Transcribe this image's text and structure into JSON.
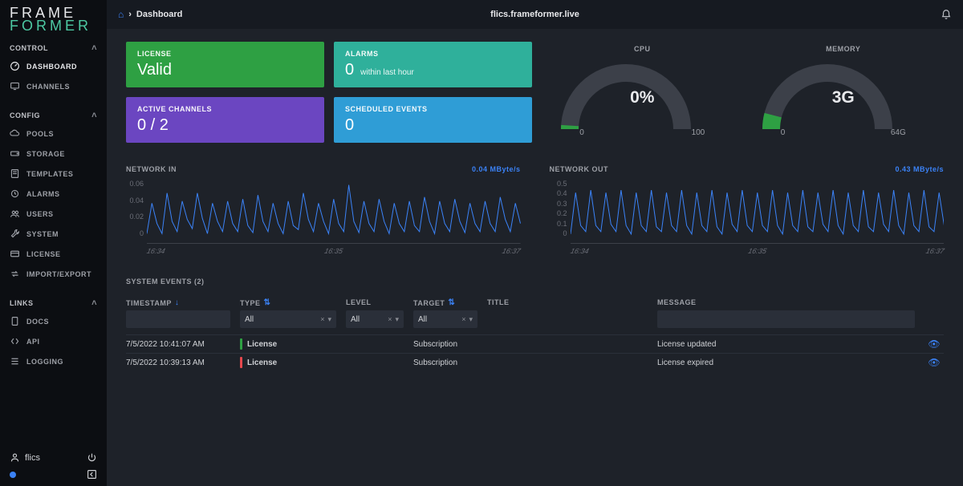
{
  "logo": {
    "line1": "FRAME",
    "line2": "FORMER"
  },
  "top": {
    "breadcrumb_page": "Dashboard",
    "host": "flics.frameformer.live"
  },
  "sidebar": {
    "sections": {
      "control_label": "CONTROL",
      "config_label": "CONFIG",
      "links_label": "LINKS"
    },
    "control": [
      {
        "label": "DASHBOARD",
        "icon": "gauge-icon",
        "active": true
      },
      {
        "label": "CHANNELS",
        "icon": "monitor-icon",
        "active": false
      }
    ],
    "config": [
      {
        "label": "POOLS",
        "icon": "cloud-icon"
      },
      {
        "label": "STORAGE",
        "icon": "drive-icon"
      },
      {
        "label": "TEMPLATES",
        "icon": "template-icon"
      },
      {
        "label": "ALARMS",
        "icon": "clock-icon"
      },
      {
        "label": "USERS",
        "icon": "users-icon"
      },
      {
        "label": "SYSTEM",
        "icon": "wrench-icon"
      },
      {
        "label": "LICENSE",
        "icon": "card-icon"
      },
      {
        "label": "IMPORT/EXPORT",
        "icon": "transfer-icon"
      }
    ],
    "links": [
      {
        "label": "DOCS",
        "icon": "doc-icon"
      },
      {
        "label": "API",
        "icon": "code-icon"
      },
      {
        "label": "LOGGING",
        "icon": "list-icon"
      }
    ],
    "user": "flics"
  },
  "cards": {
    "license_label": "LICENSE",
    "license_value": "Valid",
    "alarms_label": "ALARMS",
    "alarms_value": "0",
    "alarms_sub": "within last hour",
    "active_channels_label": "ACTIVE CHANNELS",
    "active_channels_value": "0 / 2",
    "scheduled_label": "SCHEDULED EVENTS",
    "scheduled_value": "0"
  },
  "gauges": {
    "cpu_label": "CPU",
    "cpu_value": "0%",
    "cpu_min": "0",
    "cpu_max": "100",
    "cpu_percent": 2,
    "memory_label": "MEMORY",
    "memory_value": "3G",
    "memory_min": "0",
    "memory_max": "64G",
    "memory_percent": 8
  },
  "chart_data": [
    {
      "type": "line",
      "title": "NETWORK IN",
      "rate_label": "0.04 MByte/s",
      "ylabel": "",
      "y_ticks": [
        "0.06",
        "0.04",
        "0.02",
        "0"
      ],
      "x_ticks": [
        "16:34",
        "16:35",
        "16:37"
      ],
      "ylim": [
        0,
        0.06
      ],
      "values": [
        0.01,
        0.04,
        0.02,
        0.01,
        0.05,
        0.022,
        0.012,
        0.042,
        0.024,
        0.015,
        0.05,
        0.025,
        0.01,
        0.04,
        0.022,
        0.012,
        0.042,
        0.02,
        0.012,
        0.044,
        0.018,
        0.011,
        0.048,
        0.022,
        0.012,
        0.04,
        0.02,
        0.01,
        0.042,
        0.018,
        0.014,
        0.05,
        0.024,
        0.012,
        0.04,
        0.022,
        0.01,
        0.044,
        0.02,
        0.012,
        0.058,
        0.022,
        0.011,
        0.042,
        0.02,
        0.012,
        0.044,
        0.022,
        0.01,
        0.04,
        0.02,
        0.012,
        0.042,
        0.018,
        0.012,
        0.046,
        0.022,
        0.01,
        0.042,
        0.02,
        0.012,
        0.044,
        0.022,
        0.011,
        0.04,
        0.02,
        0.012,
        0.042,
        0.02,
        0.012,
        0.046,
        0.024,
        0.012,
        0.04,
        0.02
      ]
    },
    {
      "type": "line",
      "title": "NETWORK OUT",
      "rate_label": "0.43 MByte/s",
      "ylabel": "",
      "y_ticks": [
        "0.5",
        "0.4",
        "0.3",
        "0.2",
        "0.1",
        "0"
      ],
      "x_ticks": [
        "16:34",
        "16:35",
        "16:37"
      ],
      "ylim": [
        0,
        0.5
      ],
      "values": [
        0.08,
        0.42,
        0.15,
        0.1,
        0.44,
        0.15,
        0.1,
        0.42,
        0.16,
        0.1,
        0.44,
        0.15,
        0.08,
        0.42,
        0.15,
        0.1,
        0.44,
        0.14,
        0.1,
        0.42,
        0.15,
        0.1,
        0.44,
        0.15,
        0.08,
        0.42,
        0.15,
        0.1,
        0.44,
        0.14,
        0.08,
        0.42,
        0.16,
        0.1,
        0.44,
        0.15,
        0.1,
        0.42,
        0.15,
        0.1,
        0.44,
        0.15,
        0.08,
        0.42,
        0.15,
        0.1,
        0.44,
        0.14,
        0.1,
        0.42,
        0.16,
        0.1,
        0.44,
        0.15,
        0.08,
        0.42,
        0.15,
        0.1,
        0.44,
        0.14,
        0.1,
        0.42,
        0.16,
        0.1,
        0.44,
        0.15,
        0.08,
        0.42,
        0.15,
        0.1,
        0.44,
        0.14,
        0.1,
        0.42,
        0.15
      ]
    }
  ],
  "events": {
    "title": "SYSTEM EVENTS (2)",
    "headers": {
      "timestamp": "TIMESTAMP",
      "type": "TYPE",
      "level": "LEVEL",
      "target": "TARGET",
      "title_col": "TITLE",
      "message": "MESSAGE"
    },
    "filters": {
      "type_default": "All",
      "level_default": "All",
      "target_default": "All"
    },
    "rows": [
      {
        "timestamp": "7/5/2022 10:41:07 AM",
        "type": "License",
        "level_color": "green",
        "target": "Subscription",
        "title": "",
        "message": "License updated"
      },
      {
        "timestamp": "7/5/2022 10:39:13 AM",
        "type": "License",
        "level_color": "red",
        "target": "Subscription",
        "title": "",
        "message": "License expired"
      }
    ]
  }
}
